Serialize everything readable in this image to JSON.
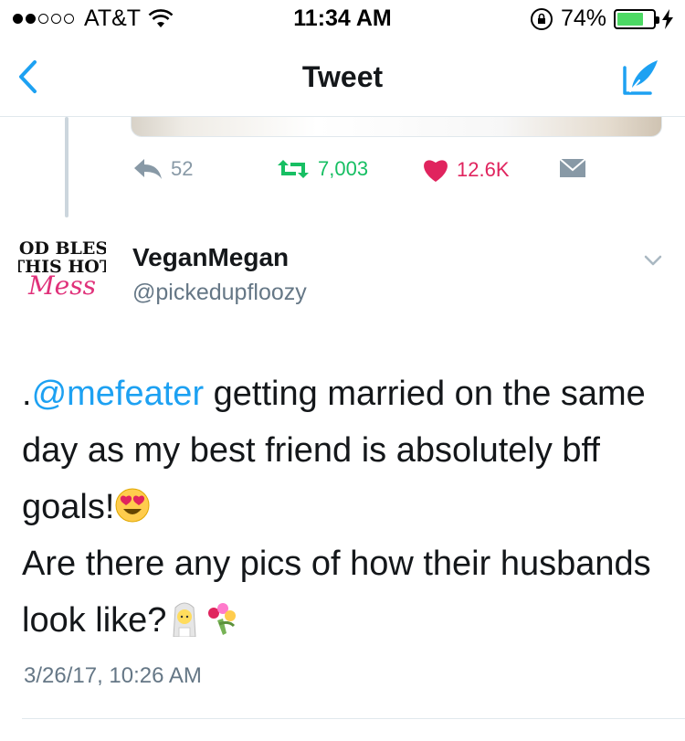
{
  "status_bar": {
    "carrier": "AT&T",
    "time": "11:34 AM",
    "battery": "74%",
    "battery_level": 0.74,
    "signal_bars_filled": 2,
    "signal_bars_total": 5
  },
  "nav": {
    "title": "Tweet",
    "accent_color": "#1da1f2"
  },
  "previous_tweet": {
    "replies": "52",
    "retweets": "7,003",
    "likes": "12.6K"
  },
  "tweet": {
    "avatar_text_line1": "GOD BLESS",
    "avatar_text_line2": "THIS HOT",
    "avatar_text_line3": "Mess",
    "display_name": "VeganMegan",
    "username": "@pickedupfloozy",
    "text_prefix": ".",
    "mention": "@mefeater",
    "text_line1_rest": " getting married on the same day as my best friend is absolutely bff goals!",
    "text_line2": "Are there any pics of how their husbands look like?",
    "emojis": [
      "heart-eyes-emoji",
      "bride-emoji",
      "bouquet-emoji"
    ],
    "timestamp": "3/26/17, 10:26 AM"
  }
}
